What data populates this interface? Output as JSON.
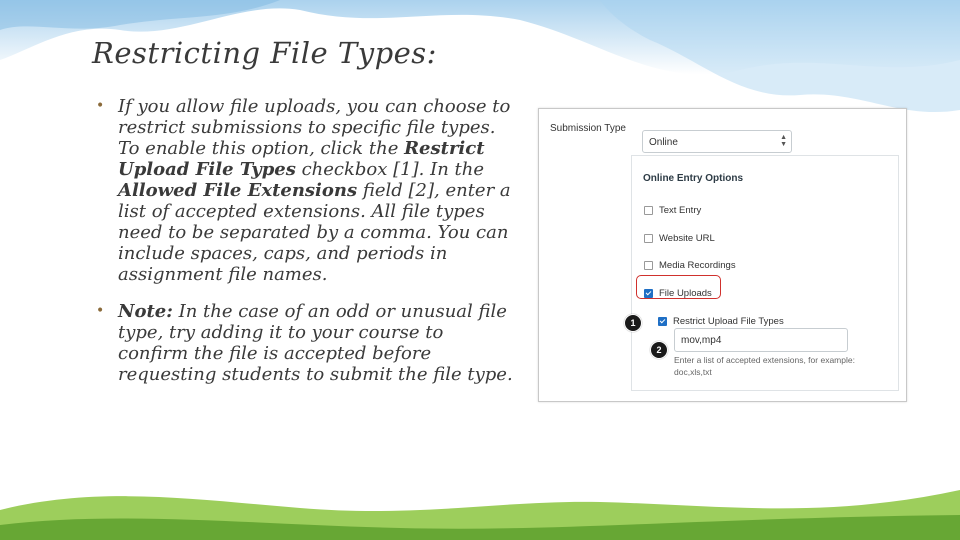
{
  "slide": {
    "title": "Restricting File Types:",
    "bullets": [
      {
        "dot": "•",
        "part1": "If you allow file uploads, you can choose to restrict submissions to specific file types. To enable this option, click the ",
        "bold1": "Restrict Upload File Types",
        "part2": " checkbox [1]. In the ",
        "bold2": "Allowed File Extensions",
        "part3": " field [2], enter a list of accepted extensions. All file types need to be separated by a comma. You can include spaces, caps, and periods in assignment file names."
      },
      {
        "dot": "•",
        "bold1": "Note:",
        "part1": " In the case of an odd or unusual file type, try adding it to your course to confirm the file is accepted before requesting students to submit the file type."
      }
    ]
  },
  "screenshot": {
    "submission_type_label": "Submission Type",
    "submission_type_value": "Online",
    "select_arrows": "▲▼",
    "online_entry_title": "Online Entry Options",
    "options": [
      {
        "label": "Text Entry",
        "checked": false
      },
      {
        "label": "Website URL",
        "checked": false
      },
      {
        "label": "Media Recordings",
        "checked": false
      },
      {
        "label": "File Uploads",
        "checked": true
      }
    ],
    "restrict_label": "Restrict Upload File Types",
    "restrict_checked": true,
    "extensions_value": "mov,mp4",
    "extensions_help": "Enter a list of accepted extensions, for example: doc,xls,txt",
    "callout_1": "1",
    "callout_2": "2"
  },
  "colors": {
    "checkbox_checked": "#1f6fc5",
    "highlight_border": "#d0312d",
    "callout_bg": "#1a1a1a",
    "title_text": "#3a3a3a"
  }
}
